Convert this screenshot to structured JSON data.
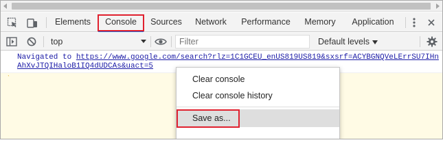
{
  "tabs": [
    {
      "label": "Elements"
    },
    {
      "label": "Console"
    },
    {
      "label": "Sources"
    },
    {
      "label": "Network"
    },
    {
      "label": "Performance"
    },
    {
      "label": "Memory"
    },
    {
      "label": "Application"
    }
  ],
  "toolbar": {
    "context": "top",
    "filter_placeholder": "Filter",
    "levels": "Default levels"
  },
  "console": {
    "prefix": "Navigated to ",
    "url": "https://www.google.com/search?rlz=1C1GCEU_enUS819US819&sxsrf=ACYBGNQVeLErrSU7IHnAhXvJTQIHaloB1IQ4dUDCAs&uact=5",
    "tick": "ˋ"
  },
  "menu": {
    "items": [
      {
        "label": "Clear console"
      },
      {
        "label": "Clear console history"
      },
      {
        "label": "Save as..."
      }
    ]
  },
  "colors": {
    "highlight": "#e0202e",
    "console_bg": "#fffbe5",
    "link": "#1a1aa6"
  }
}
